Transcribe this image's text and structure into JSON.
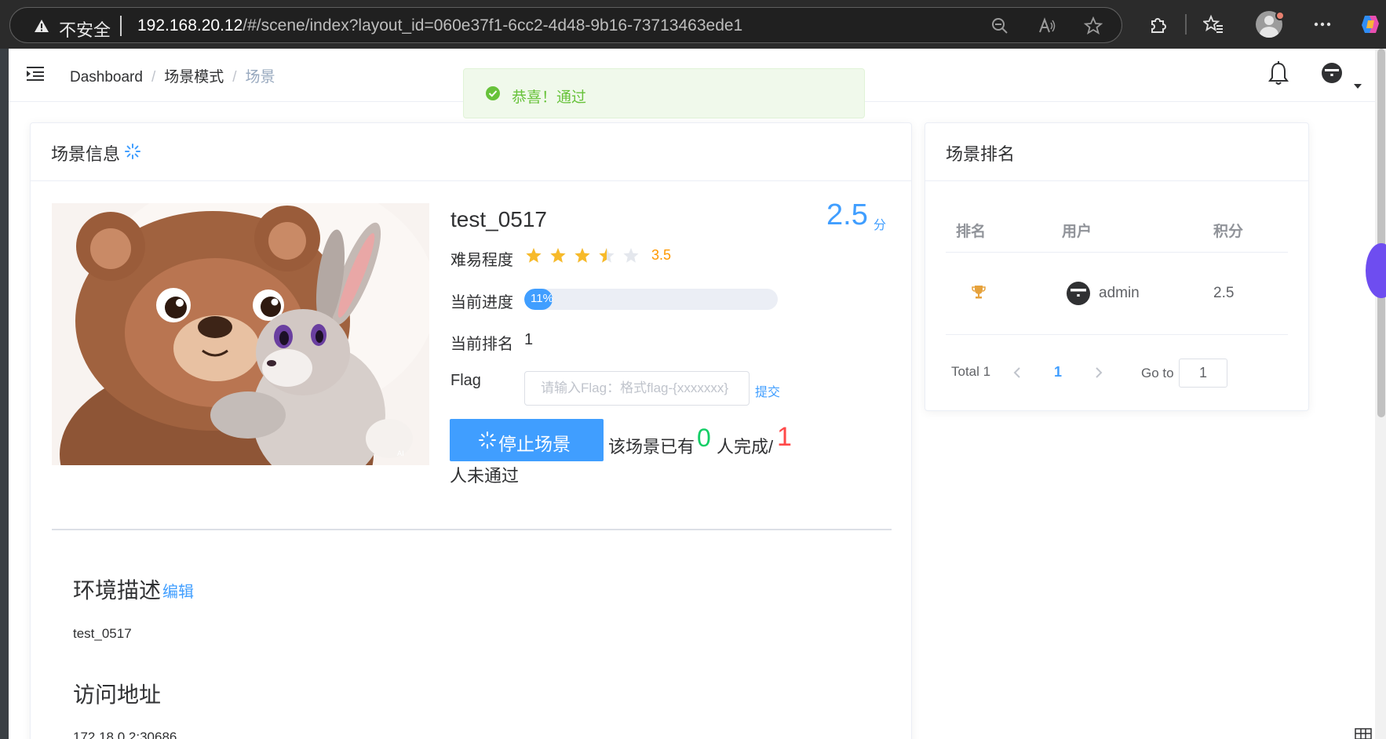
{
  "browser": {
    "security_label": "不安全",
    "url_host": "192.168.20.12",
    "url_path": "/#/scene/index?layout_id=060e37f1-6cc2-4d48-9b16-73713463ede1"
  },
  "header": {
    "breadcrumb": [
      "Dashboard",
      "场景模式",
      "场景"
    ]
  },
  "toast": {
    "message": "恭喜！通过",
    "color": "#67c23a"
  },
  "scene_card": {
    "title": "场景信息",
    "name": "test_0517",
    "score": "2.5",
    "score_unit": "分",
    "difficulty_label": "难易程度",
    "difficulty_value": "3.5",
    "difficulty_rating": 3.5,
    "difficulty_max": 5,
    "progress_label": "当前进度",
    "progress_percent": 11,
    "progress_text": "11%",
    "rank_label": "当前排名",
    "rank_value": "1",
    "flag_label": "Flag",
    "flag_placeholder": "请输入Flag：格式flag-{xxxxxxx}",
    "submit_label": "提交",
    "stop_button_label": "停止场景",
    "stats_prefix": "该场景已有",
    "completed_count": "0",
    "stats_mid": "人完成/",
    "failed_count": "1",
    "stats_suffix": "人未通过",
    "env_heading": "环境描述",
    "edit_label": "编辑",
    "env_description": "test_0517",
    "address_heading": "访问地址",
    "address_value": "172.18.0.2:30686"
  },
  "ranking_card": {
    "title": "场景排名",
    "columns": [
      "排名",
      "用户",
      "积分"
    ],
    "rows": [
      {
        "user": "admin",
        "score": "2.5"
      }
    ],
    "pagination": {
      "total_label": "Total 1",
      "current_page": "1",
      "goto_label": "Go to",
      "goto_value": "1"
    }
  },
  "colors": {
    "primary": "#409eff",
    "success": "#13ce66",
    "danger": "#ff4949",
    "star": "#f7ba2a"
  }
}
